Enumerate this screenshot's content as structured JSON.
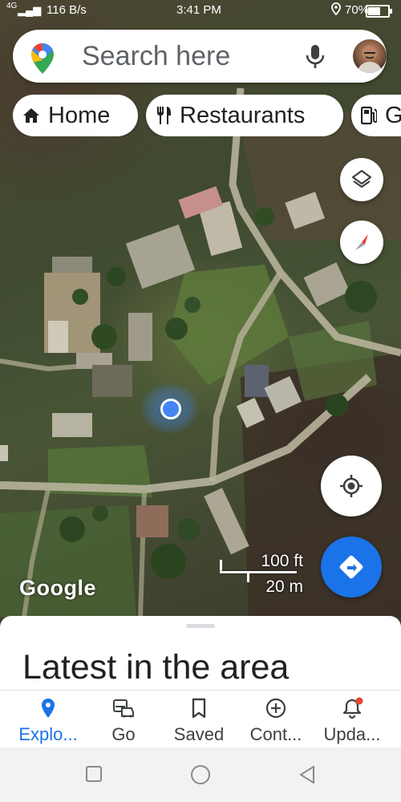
{
  "status_bar": {
    "network": "4G",
    "speed": "116 B/s",
    "time": "3:41 PM",
    "battery": "70%",
    "battery_level": 0.7
  },
  "search": {
    "placeholder": "Search here",
    "icons": [
      "maps-pin-icon",
      "mic-icon",
      "profile-avatar"
    ]
  },
  "chips": [
    {
      "label": "Home",
      "icon": "home-icon"
    },
    {
      "label": "Restaurants",
      "icon": "restaurant-icon"
    },
    {
      "label": "G",
      "icon": "gas-station-icon"
    }
  ],
  "map": {
    "attribution": "Google",
    "scale_imperial": "100 ft",
    "scale_metric": "20 m",
    "controls": [
      "layers-icon",
      "compass-icon",
      "my-location-icon",
      "directions-icon"
    ]
  },
  "sheet": {
    "title": "Latest in the area"
  },
  "bottom_nav": [
    {
      "label": "Explo...",
      "icon": "explore-pin-icon",
      "active": true
    },
    {
      "label": "Go",
      "icon": "commute-icon",
      "active": false
    },
    {
      "label": "Saved",
      "icon": "bookmark-icon",
      "active": false
    },
    {
      "label": "Cont...",
      "icon": "add-circle-icon",
      "active": false
    },
    {
      "label": "Upda...",
      "icon": "notifications-icon",
      "active": false
    }
  ],
  "system_nav": [
    "recents-icon",
    "home-circle-icon",
    "back-icon"
  ],
  "colors": {
    "accent": "#1a73e8",
    "location": "#4285f4",
    "compass_red": "#ea4335",
    "notification_dot": "#ea4335"
  }
}
